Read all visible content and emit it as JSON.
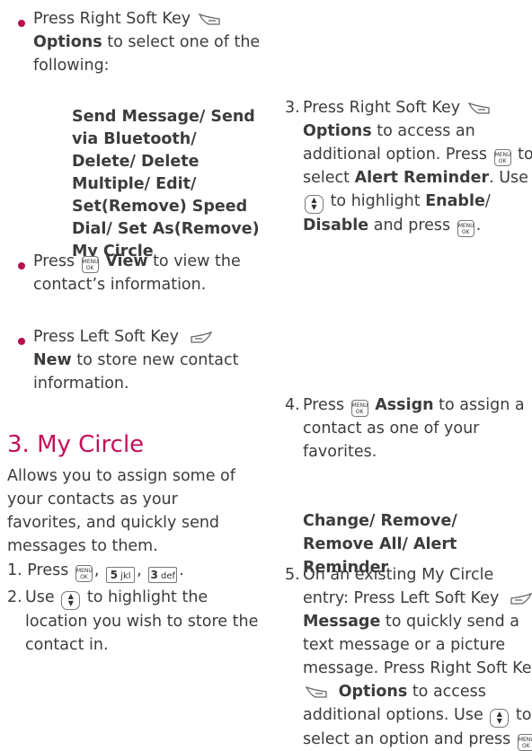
{
  "left": {
    "bullet1": {
      "pre": "Press Right Soft Key",
      "b1": "Options",
      "post": " to select one of the following:"
    },
    "options_list": "Send Message/ Send via Bluetooth/ Delete/ Delete Multiple/ Edit/ Set(Remove) Speed Dial/ Set As(Remove) My Circle",
    "bullet2": {
      "pre": "Press",
      "b1": "View",
      "post": " to view the contact’s information."
    },
    "bullet3": {
      "pre": "Press Left Soft Key",
      "b1": "New",
      "post": " to store new contact information."
    },
    "heading": "3. My Circle",
    "intro": "Allows you to assign some of your contacts as your favorites, and quickly send messages to them.",
    "step1": {
      "n": "1.",
      "pre": "Press",
      "sep1": ",",
      "sep2": ",",
      "end": "."
    },
    "step2": {
      "n": "2.",
      "pre": "Use",
      "post": " to highlight the location you wish to store the contact in."
    }
  },
  "right": {
    "step3": {
      "n": "3.",
      "pre": "Press Right Soft Key",
      "b1": "Options",
      "mid1": " to access an additional option. Press",
      "mid2": " to select ",
      "b2": "Alert Reminder",
      "mid3": ". Use",
      "mid4": " to highlight ",
      "b3": "Enable",
      "slash": "/",
      "b4": "Disable",
      "mid5": " and press",
      "end": "."
    },
    "step4": {
      "n": "4.",
      "pre": "Press",
      "b1": "Assign",
      "post": " to assign a contact as one of your favorites."
    },
    "step5": {
      "n": "5.",
      "pre": "On an existing My Circle entry: Press Left Soft Key",
      "b1": "Message",
      "mid1": " to quickly send a text message or a picture message. Press Right Soft Key",
      "b2": "Options",
      "mid2": " to access additional options. Use",
      "mid3": " to select an option and press",
      "end": "."
    },
    "options_list": "Change/ Remove/ Remove All/ Alert Reminder"
  },
  "keys": {
    "ok_top": "MENU",
    "ok_bottom": "OK",
    "nav_up": "▲",
    "nav_down": "▼",
    "key5_big": "5",
    "key5_small": "jkl",
    "key3_big": "3",
    "key3_small": "def"
  },
  "colors": {
    "heading": "#c3105a",
    "bullet": "#b80f4e",
    "text": "#3c3c3c"
  }
}
